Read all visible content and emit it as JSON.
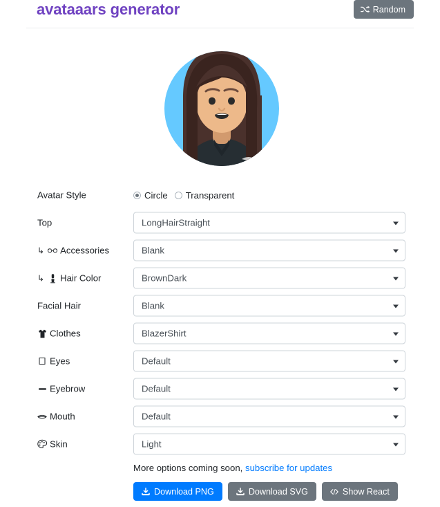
{
  "header": {
    "title": "avataaars generator",
    "title_color": "#6f42c1",
    "random_button": {
      "label": "Random",
      "icon": "shuffle-icon",
      "color": "#6c757d"
    }
  },
  "avatar": {
    "alt": "avatar-preview",
    "background_color": "#65C9FF",
    "skin_color": "#EDB98A",
    "hair_color": "#4A312C",
    "clothes_color": "#262E33",
    "style": "Circle",
    "top": "LongHairStraight"
  },
  "form": {
    "rows": [
      {
        "label": "Avatar Style",
        "icon": null,
        "nested": false,
        "control": "radio",
        "options": [
          {
            "label": "Circle",
            "checked": true
          },
          {
            "label": "Transparent",
            "checked": false
          }
        ]
      },
      {
        "label": "Top",
        "icon": null,
        "nested": false,
        "control": "select",
        "value": "LongHairStraight"
      },
      {
        "label": "Accessories",
        "icon": "glasses-icon",
        "nested": true,
        "control": "select",
        "value": "Blank"
      },
      {
        "label": "Hair Color",
        "icon": "paintbrush-icon",
        "nested": true,
        "control": "select",
        "value": "BrownDark"
      },
      {
        "label": "Facial Hair",
        "icon": null,
        "nested": false,
        "control": "select",
        "value": "Blank"
      },
      {
        "label": "Clothes",
        "icon": "tshirt-icon",
        "nested": false,
        "control": "select",
        "value": "BlazerShirt"
      },
      {
        "label": "Eyes",
        "icon": "eye-icon",
        "nested": false,
        "control": "select",
        "value": "Default"
      },
      {
        "label": "Eyebrow",
        "icon": "eyebrow-icon",
        "nested": false,
        "control": "select",
        "value": "Default"
      },
      {
        "label": "Mouth",
        "icon": "mouth-icon",
        "nested": false,
        "control": "select",
        "value": "Default"
      },
      {
        "label": "Skin",
        "icon": "palette-icon",
        "nested": false,
        "control": "select",
        "value": "Light"
      }
    ],
    "nested_marker": "↳"
  },
  "footer": {
    "note_text": "More options coming soon, ",
    "note_link": "subscribe for updates",
    "buttons": [
      {
        "label": "Download PNG",
        "icon": "download-icon",
        "style": "primary"
      },
      {
        "label": "Download SVG",
        "icon": "download-icon",
        "style": "secondary"
      },
      {
        "label": "Show React",
        "icon": "code-icon",
        "style": "secondary"
      }
    ]
  }
}
